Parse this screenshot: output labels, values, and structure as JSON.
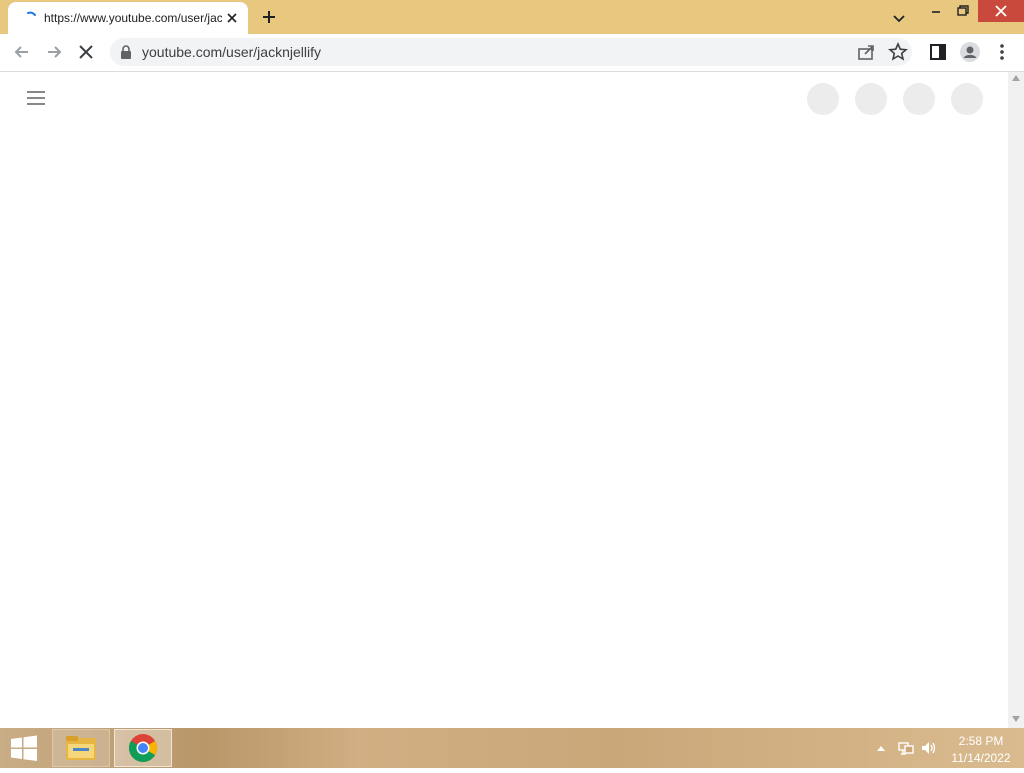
{
  "browser": {
    "tab": {
      "title": "https://www.youtube.com/user/jacknjellify",
      "loading": true
    },
    "url": "youtube.com/user/jacknjellify",
    "theme_color": "#e8c77f",
    "icons": {
      "back": "arrow-left-icon",
      "forward": "arrow-right-icon",
      "stop": "close-icon",
      "lock": "lock-icon",
      "share": "share-icon",
      "bookmark": "star-icon",
      "side_panel": "side-panel-icon",
      "profile": "profile-icon",
      "menu": "kebab-menu-icon"
    }
  },
  "page": {
    "menu_icon": "hamburger-menu-icon",
    "skeleton_count": 4
  },
  "taskbar": {
    "apps": [
      "File Explorer",
      "Google Chrome"
    ],
    "clock": {
      "time": "2:58 PM",
      "date": "11/14/2022"
    }
  }
}
